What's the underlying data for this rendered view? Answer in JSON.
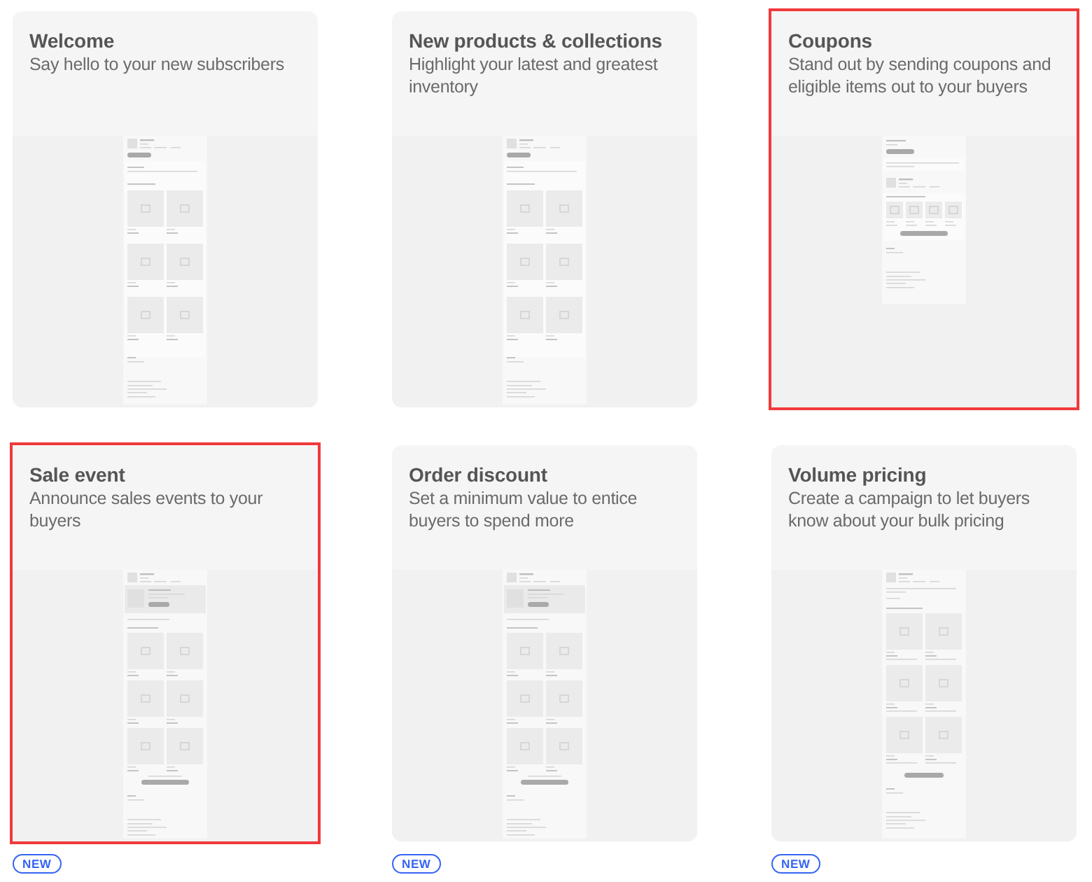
{
  "cards": [
    {
      "title": "Welcome",
      "description": "Say hello to your new subscribers",
      "selected": false,
      "kind": "product_grid"
    },
    {
      "title": "New products & collections",
      "description": "Highlight your latest and greatest inventory",
      "selected": false,
      "kind": "product_grid"
    },
    {
      "title": "Coupons",
      "description": "Stand out by sending coupons and eligible items out to your buyers",
      "selected": true,
      "kind": "coupon"
    },
    {
      "title": "Sale event",
      "description": "Announce sales events to your buyers",
      "selected": true,
      "kind": "sale_banner",
      "badge": "NEW"
    },
    {
      "title": "Order discount",
      "description": "Set a minimum value to entice buyers to spend more",
      "selected": false,
      "kind": "sale_banner",
      "badge": "NEW"
    },
    {
      "title": "Volume pricing",
      "description": "Create a campaign to let buyers know about your bulk pricing",
      "selected": false,
      "kind": "bulk_grid",
      "badge": "NEW"
    }
  ]
}
